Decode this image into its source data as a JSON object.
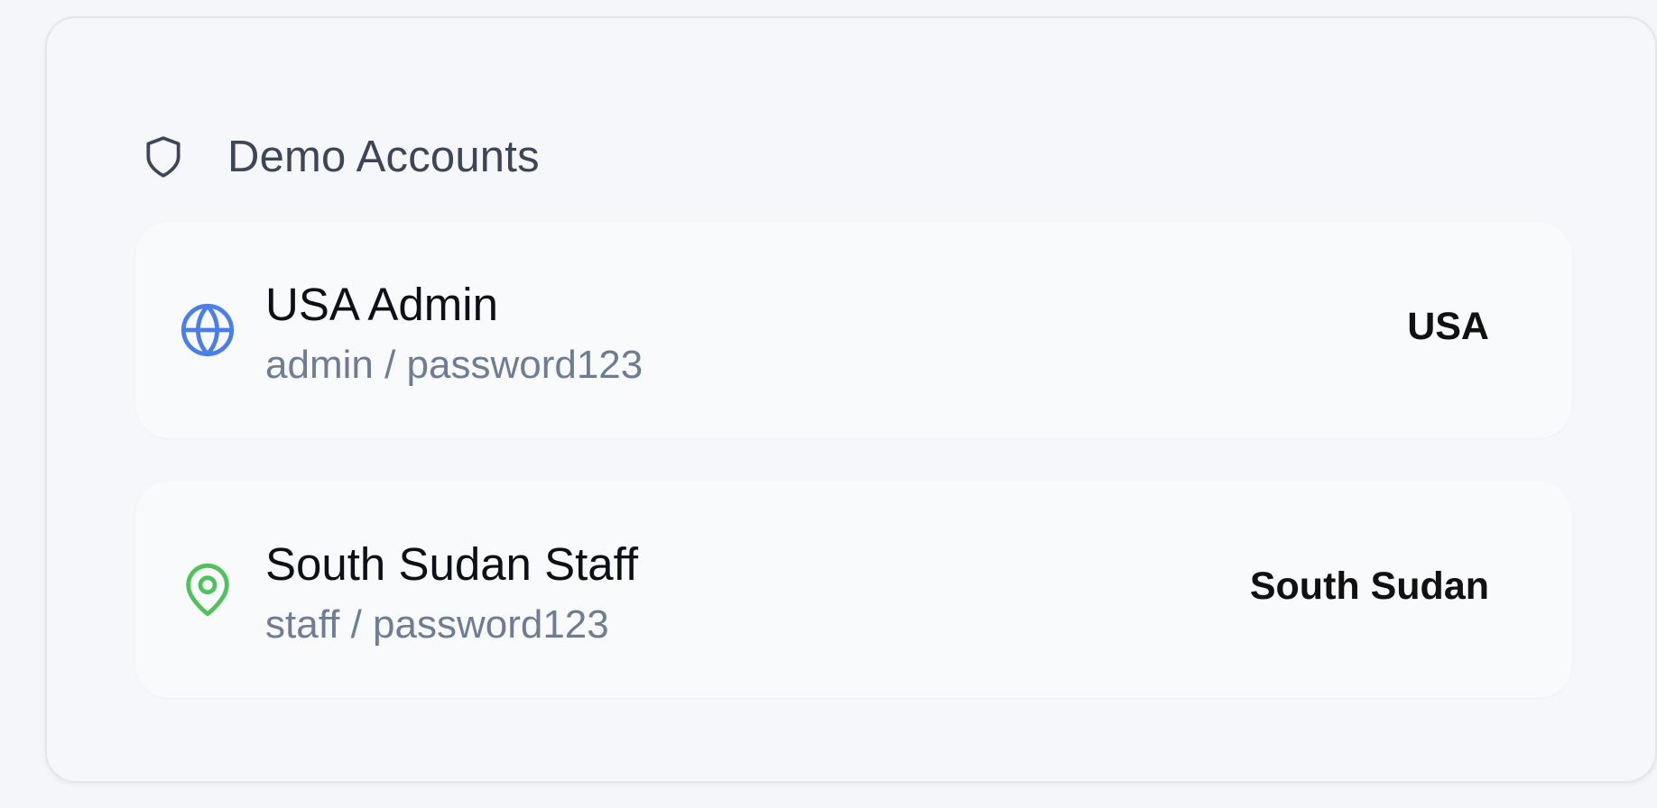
{
  "demo_accounts": {
    "title": "Demo Accounts",
    "header_icon": "shield-icon",
    "accounts": [
      {
        "name": "USA Admin",
        "credentials": "admin / password123",
        "region": "USA",
        "icon": "globe-icon",
        "icon_color": "#4a7fe8"
      },
      {
        "name": "South Sudan Staff",
        "credentials": "staff / password123",
        "region": "South Sudan",
        "icon": "map-pin-icon",
        "icon_color": "#4fc25c"
      }
    ]
  },
  "colors": {
    "background": "#f4f6f9",
    "card_background": "#f5f7fa",
    "account_background": "#f9fafc",
    "title_color": "#3d4557",
    "credentials_color": "#6f7d94"
  }
}
